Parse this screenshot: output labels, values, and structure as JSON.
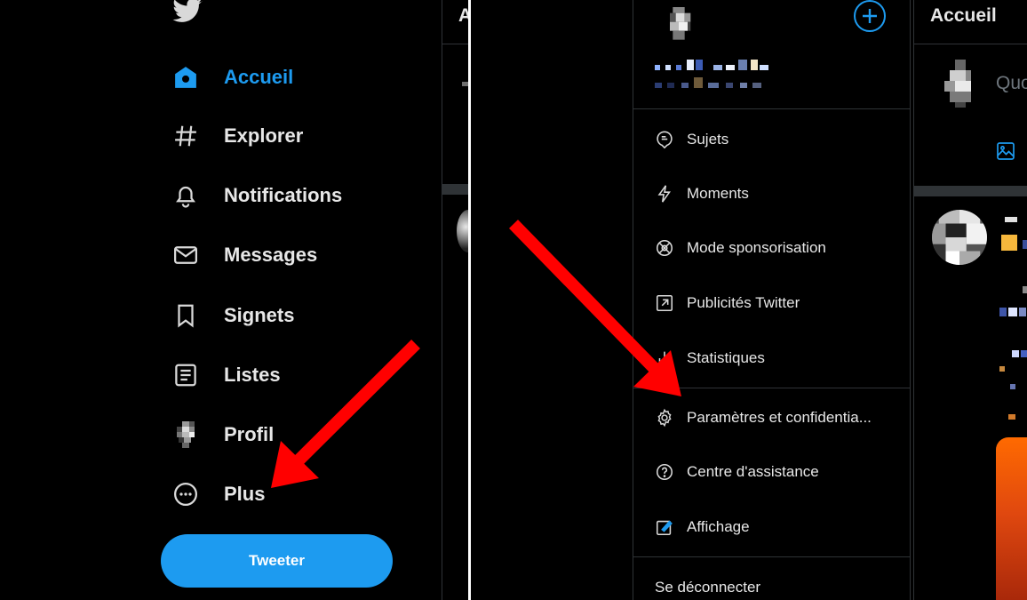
{
  "left": {
    "nav": [
      {
        "label": "Accueil",
        "icon": "home-icon",
        "active": true
      },
      {
        "label": "Explorer",
        "icon": "hashtag-icon",
        "active": false
      },
      {
        "label": "Notifications",
        "icon": "bell-icon",
        "active": false
      },
      {
        "label": "Messages",
        "icon": "envelope-icon",
        "active": false
      },
      {
        "label": "Signets",
        "icon": "bookmark-icon",
        "active": false
      },
      {
        "label": "Listes",
        "icon": "list-icon",
        "active": false
      },
      {
        "label": "Profil",
        "icon": "avatar-icon",
        "active": false
      },
      {
        "label": "Plus",
        "icon": "more-circle-icon",
        "active": false
      }
    ],
    "tweet_button": "Tweeter"
  },
  "right": {
    "menu": [
      {
        "label": "Sujets",
        "icon": "topics-icon"
      },
      {
        "label": "Moments",
        "icon": "lightning-icon"
      },
      {
        "label": "Mode sponsorisation",
        "icon": "sponsor-icon"
      },
      {
        "label": "Publicités Twitter",
        "icon": "external-link-icon"
      },
      {
        "label": "Statistiques",
        "icon": "bar-chart-icon"
      },
      {
        "label": "Paramètres et confidentia...",
        "icon": "gear-icon"
      },
      {
        "label": "Centre d'assistance",
        "icon": "help-icon"
      },
      {
        "label": "Affichage",
        "icon": "display-icon"
      }
    ],
    "logout": "Se déconnecter",
    "header": "Accueil",
    "compose_placeholder": "Quo"
  },
  "colors": {
    "accent": "#1d9bf0",
    "arrow": "#ff0000",
    "background": "#000000"
  }
}
